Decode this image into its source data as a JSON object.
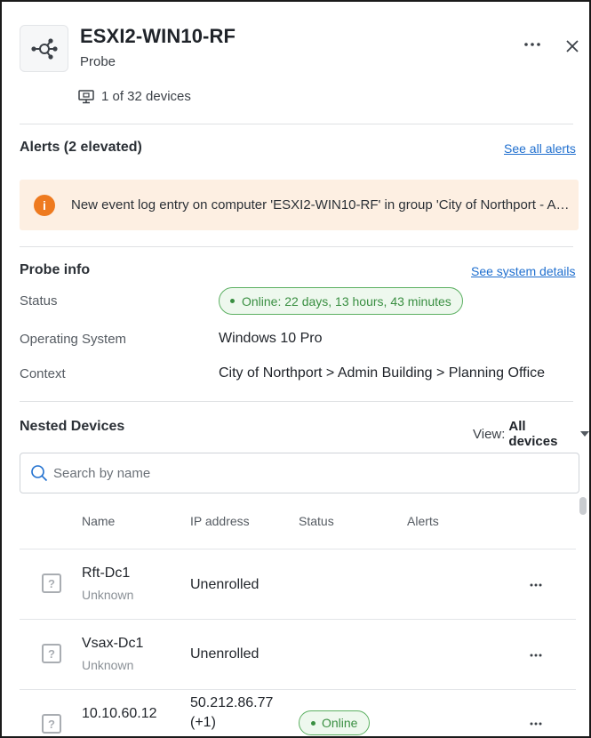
{
  "header": {
    "title": "ESXI2-WIN10-RF",
    "subtitle": "Probe",
    "device_count": "1 of 32 devices",
    "logo_icon": "network-hub-icon",
    "more_icon": "more-horizontal-icon",
    "close_icon": "close-icon"
  },
  "alerts": {
    "title": "Alerts (2 elevated)",
    "see_all_link": "See all alerts",
    "banner_text": "New event log entry on computer 'ESXI2-WIN10-RF' in group 'City of Northport - Admin Building - Planning Office'",
    "banner_icon": "info-icon",
    "banner_color": "#fdefe2",
    "icon_color": "#ee7a1f"
  },
  "probe_info": {
    "title": "Probe info",
    "details_link": "See system details",
    "status_label": "Status",
    "status_value": "Online: 22 days, 13 hours, 43 minutes",
    "os_label": "Operating System",
    "os_value": "Windows 10 Pro",
    "context_label": "Context",
    "context_value": "City of Northport > Admin Building > Planning Office",
    "online_color": "#3a8f42"
  },
  "nested": {
    "title": "Nested Devices",
    "view_label": "View:",
    "view_value": "All devices",
    "search_placeholder": "Search by name",
    "columns": {
      "name": "Name",
      "ip": "IP address",
      "status": "Status",
      "alerts": "Alerts"
    },
    "rows": [
      {
        "name": "Rft-Dc1",
        "type": "Unknown",
        "ip": "Unenrolled",
        "ip_extra": "",
        "status": "",
        "icon": "unknown-device-icon"
      },
      {
        "name": "Vsax-Dc1",
        "type": "Unknown",
        "ip": "Unenrolled",
        "ip_extra": "",
        "status": "",
        "icon": "unknown-device-icon"
      },
      {
        "name": "10.10.60.12",
        "type": "",
        "ip": "50.212.86.77",
        "ip_extra": "(+1)",
        "status": "Online",
        "icon": "unknown-device-icon"
      }
    ]
  },
  "link_color": "#1f6fcf"
}
